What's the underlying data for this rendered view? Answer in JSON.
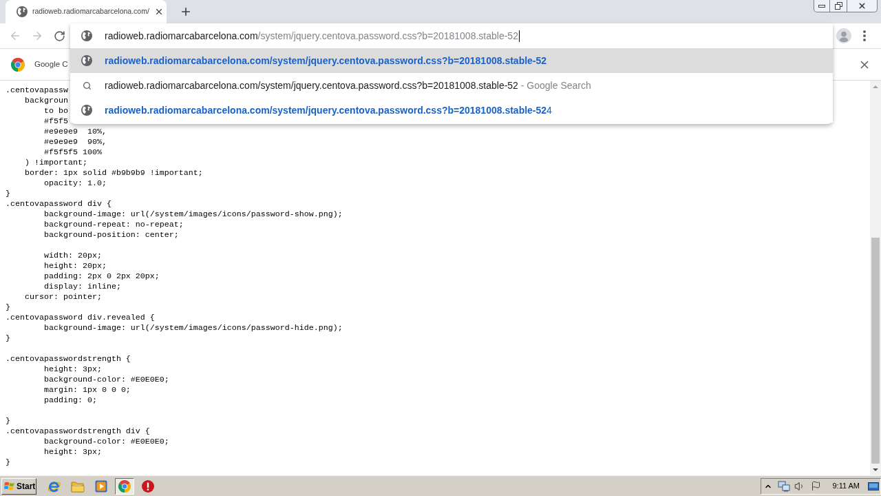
{
  "browser": {
    "tabs": [
      {
        "title": "radioweb.radiomarcabarcelona.com/",
        "selected": true
      }
    ],
    "toolbar": {
      "back": {
        "disabled": true
      },
      "forward": {
        "disabled": true
      }
    },
    "omnibox": {
      "host": "radioweb.radiomarcabarcelona.com",
      "path": "/system/jquery.centova.password.css?b=20181008.stable-52",
      "suggestions": [
        {
          "kind": "url",
          "selected": true,
          "match": "radioweb.radiomarcabarcelona.com/system/jquery.centova.password.css?b=20181008.stable-52"
        },
        {
          "kind": "search",
          "selected": false,
          "text": "radioweb.radiomarcabarcelona.com/system/jquery.centova.password.css?b=20181008.stable-52",
          "suffix": "- Google Search"
        },
        {
          "kind": "url",
          "selected": false,
          "match": "radioweb.radiomarcabarcelona.com/system/jquery.centova.password.css?b=20181008.stable-52",
          "rest": "4"
        }
      ]
    },
    "infobar": {
      "message": "Google C"
    }
  },
  "page": {
    "partly_hidden_lines": [
      ".centovapassw",
      "    backgroun",
      "        to bo",
      "        #f5f5"
    ],
    "source": "        #e9e9e9  10%,\n        #e9e9e9  90%,\n        #f5f5f5 100%\n    ) !important;\n    border: 1px solid #b9b9b9 !important;\n        opacity: 1.0;\n}\n.centovapassword div {\n        background-image: url(/system/images/icons/password-show.png);\n        background-repeat: no-repeat;\n        background-position: center;\n\n        width: 20px;\n        height: 20px;\n        padding: 2px 0 2px 20px;\n        display: inline;\n    cursor: pointer;\n}\n.centovapassword div.revealed {\n        background-image: url(/system/images/icons/password-hide.png);\n}\n\n.centovapasswordstrength {\n        height: 3px;\n        background-color: #E0E0E0;\n        margin: 1px 0 0 0;\n        padding: 0;\n\n}\n.centovapasswordstrength div {\n        background-color: #E0E0E0;\n        height: 3px;\n}"
  },
  "taskbar": {
    "start": "Start",
    "apps": [
      {
        "kind": "browser",
        "selected": false
      },
      {
        "kind": "folder",
        "selected": false
      },
      {
        "kind": "media",
        "selected": false
      },
      {
        "kind": "chrome",
        "selected": true
      },
      {
        "kind": "alert",
        "selected": false
      }
    ],
    "clock": "9:11 AM"
  }
}
